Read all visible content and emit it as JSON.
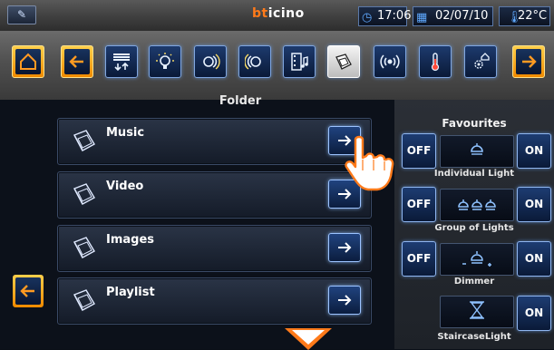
{
  "status_bar": {
    "brand_prefix": "bt",
    "brand_suffix": "icino",
    "time": "17:06",
    "date": "02/07/10",
    "temperature": "22°C",
    "icons": [
      "pencil-icon",
      "clock-icon",
      "calendar-icon",
      "thermometer-icon"
    ]
  },
  "toolbar": {
    "items": [
      {
        "name": "home",
        "icon": "home-icon"
      },
      {
        "name": "back",
        "icon": "arrow-left-icon"
      },
      {
        "name": "shutters",
        "icon": "shutters-icon"
      },
      {
        "name": "lighting",
        "icon": "light-bulb-icon"
      },
      {
        "name": "scenarios",
        "icon": "scenario-icon"
      },
      {
        "name": "scenario-modules",
        "icon": "scenario-modules-icon"
      },
      {
        "name": "multimedia",
        "icon": "film-music-icon"
      },
      {
        "name": "folders",
        "icon": "folders-icon"
      },
      {
        "name": "audio",
        "icon": "audio-waves-icon"
      },
      {
        "name": "temperature",
        "icon": "thermometer-icon"
      },
      {
        "name": "house-settings",
        "icon": "house-gear-icon"
      },
      {
        "name": "forward",
        "icon": "arrow-right-icon"
      }
    ]
  },
  "folder": {
    "title": "Folder",
    "items": [
      {
        "label": "Music"
      },
      {
        "label": "Video"
      },
      {
        "label": "Images"
      },
      {
        "label": "Playlist"
      }
    ]
  },
  "favourites": {
    "title": "Favourites",
    "off_label": "OFF",
    "on_label": "ON",
    "items": [
      {
        "label": "Individual Light"
      },
      {
        "label": "Group of Lights"
      },
      {
        "label": "Dimmer"
      },
      {
        "label": "StaircaseLight"
      }
    ]
  },
  "colors": {
    "accent_orange": "#ff7a1a",
    "button_blue": "#1d3c72",
    "glow_blue": "#8fb6f0",
    "gold_frame": "#f0a000"
  }
}
